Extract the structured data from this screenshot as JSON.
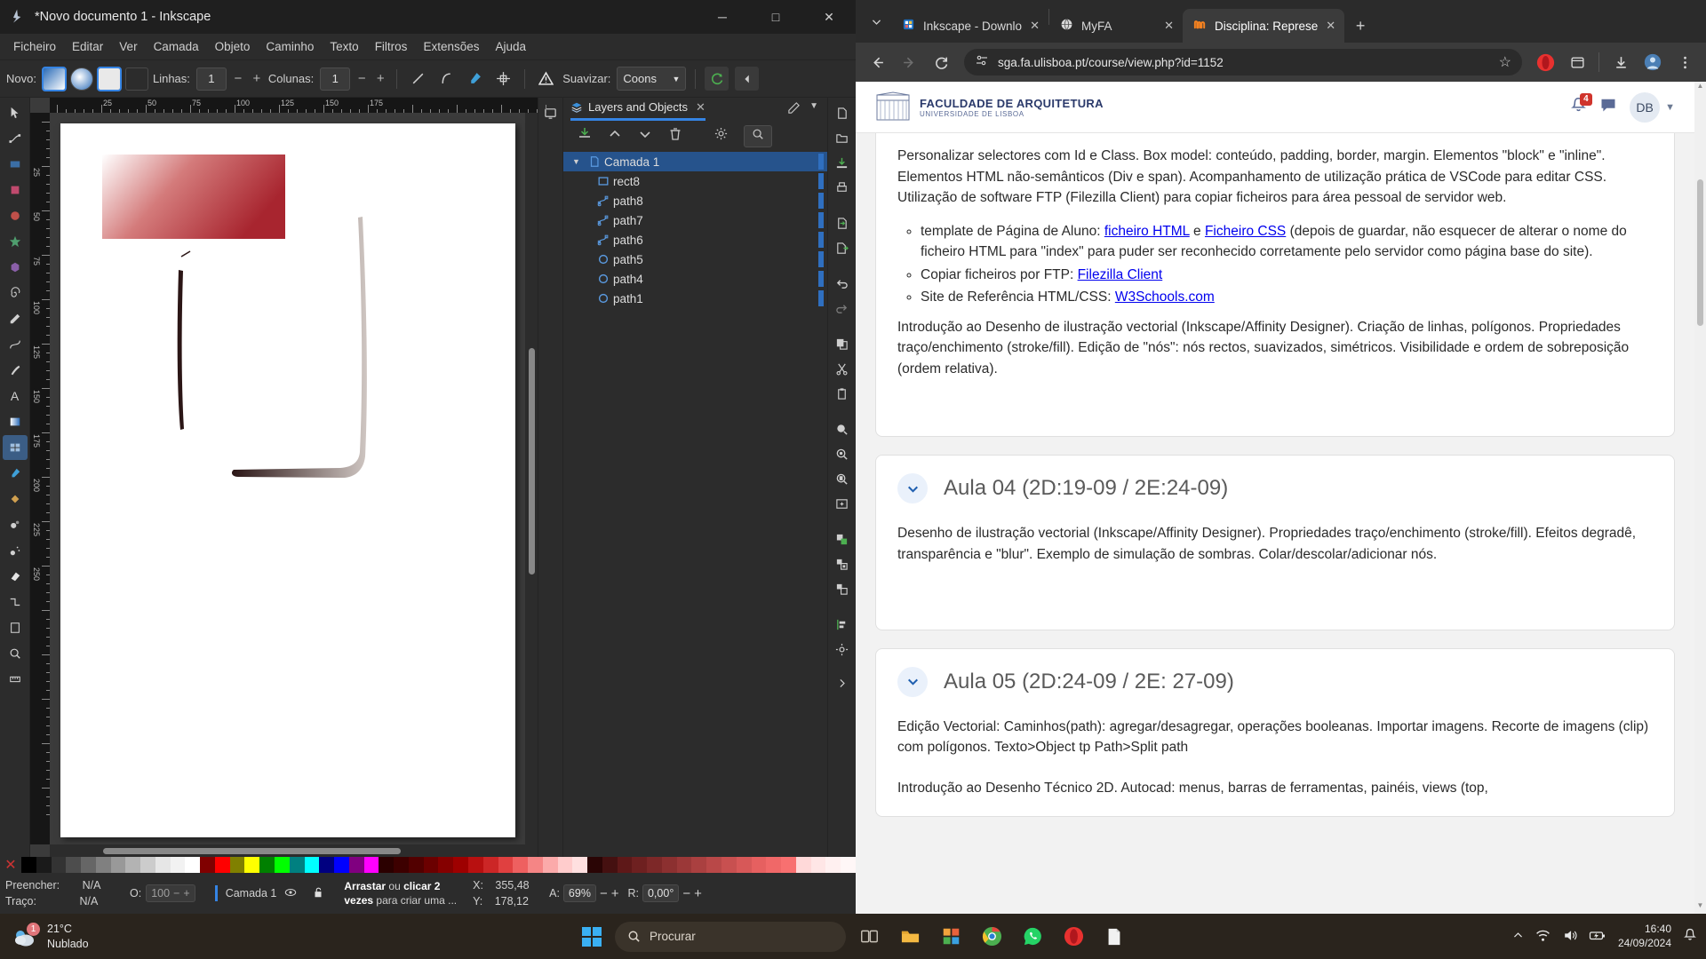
{
  "inkscape": {
    "title": "*Novo documento 1 - Inkscape",
    "window_controls": {
      "minimize": "─",
      "maximize": "□",
      "close": "✕"
    },
    "menus": [
      "Ficheiro",
      "Editar",
      "Ver",
      "Camada",
      "Objeto",
      "Caminho",
      "Texto",
      "Filtros",
      "Extensões",
      "Ajuda"
    ],
    "toolbar": {
      "novo_label": "Novo:",
      "linhas_label": "Linhas:",
      "linhas_value": "1",
      "colunas_label": "Colunas:",
      "colunas_value": "1",
      "suavizar_label": "Suavizar:",
      "suavizar_value": "Coons",
      "minus": "−",
      "plus": "+"
    },
    "dock": {
      "tab_label": "Layers and Objects",
      "tab_close": "✕",
      "layers": [
        {
          "name": "Camada 1",
          "icon": "layer-icon",
          "selected": true,
          "indent": false
        },
        {
          "name": "rect8",
          "icon": "rect-icon",
          "selected": false,
          "indent": true
        },
        {
          "name": "path8",
          "icon": "path-icon",
          "selected": false,
          "indent": true
        },
        {
          "name": "path7",
          "icon": "path-icon",
          "selected": false,
          "indent": true
        },
        {
          "name": "path6",
          "icon": "path-icon",
          "selected": false,
          "indent": true
        },
        {
          "name": "path5",
          "icon": "circle-icon",
          "selected": false,
          "indent": true
        },
        {
          "name": "path4",
          "icon": "circle-icon",
          "selected": false,
          "indent": true
        },
        {
          "name": "path1",
          "icon": "circle-icon",
          "selected": false,
          "indent": true
        }
      ]
    },
    "status": {
      "preencher_label": "Preencher:",
      "preencher_value": "N/A",
      "traco_label": "Traço:",
      "traco_value": "N/A",
      "opacity_label": "O:",
      "opacity_value": "100",
      "layer_name": "Camada 1",
      "hint_line1_bold_a": "Arrastar",
      "hint_line1_mid": " ou ",
      "hint_line1_bold_b": "clicar 2",
      "hint_line2_bold": "vezes",
      "hint_line2_rest": " para criar uma ...",
      "x_label": "X:",
      "x_value": "355,48",
      "y_label": "Y:",
      "y_value": "178,12",
      "zoom_label": "A:",
      "zoom_value": "69%",
      "rotate_label": "R:",
      "rotate_value": "0,00°",
      "minus": "−",
      "plus": "+"
    },
    "rulers": {
      "horizontal": [
        "25",
        "50",
        "75",
        "100",
        "125",
        "150",
        "175"
      ],
      "vertical": [
        "25",
        "50",
        "75",
        "100",
        "125",
        "150",
        "175",
        "200",
        "225",
        "250"
      ]
    }
  },
  "opera": {
    "tabs": [
      {
        "label": "Inkscape - Downlo",
        "icon": "inkscape-store-icon",
        "active": false,
        "close": "✕"
      },
      {
        "label": "MyFA",
        "icon": "globe-icon",
        "active": false,
        "close": "✕"
      },
      {
        "label": "Disciplina: Represe",
        "icon": "moodle-icon",
        "active": true,
        "close": "✕"
      }
    ],
    "new_tab": "+",
    "nav": {
      "back": "←",
      "forward": "→",
      "reload": "⟳",
      "url": "sga.fa.ulisboa.pt/course/view.php?id=1152",
      "bookmark": "☆"
    }
  },
  "moodle": {
    "brand_line1": "FACULDADE DE ARQUITETURA",
    "brand_line2": "UNIVERSIDADE DE LISBOA",
    "notification_count": "4",
    "user_initials": "DB",
    "section_prev": {
      "paragraph": "Personalizar selectores com Id e Class. Box model: conteúdo, padding, border, margin. Elementos \"block\" e \"inline\". Elementos HTML não-semânticos (Div e span).  Acompanhamento de utilização prática de VSCode para editar CSS. Utilização de software FTP (Filezilla Client) para copiar ficheiros para área pessoal de servidor web.",
      "bullets": [
        {
          "pre": "template de Página de Aluno: ",
          "link1": "ficheiro HTML",
          "mid": " e ",
          "link2": "Ficheiro CSS",
          "post": " (depois de guardar, não esquecer de alterar o nome do ficheiro HTML para \"index\" para puder ser reconhecido corretamente pelo servidor como página base do site)."
        },
        {
          "pre": "Copiar ficheiros por FTP: ",
          "link1": "Filezilla Client",
          "mid": "",
          "link2": "",
          "post": ""
        },
        {
          "pre": "Site de Referência HTML/CSS: ",
          "link1": "W3Schools.com",
          "mid": "",
          "link2": "",
          "post": ""
        }
      ],
      "paragraph2": "Introdução ao Desenho de ilustração vectorial (Inkscape/Affinity Designer). Criação de linhas, polígonos. Propriedades traço/enchimento (stroke/fill). Edição de \"nós\": nós rectos, suavizados, simétricos. Visibilidade e ordem de sobreposição (ordem relativa)."
    },
    "section_aula04": {
      "title": "Aula 04 (2D:19-09 / 2E:24-09)",
      "toggle_icon": "chevron-down-icon",
      "paragraph": "Desenho de ilustração vectorial (Inkscape/Affinity Designer). Propriedades traço/enchimento (stroke/fill). Efeitos degradê, transparência e \"blur\". Exemplo de simulação de sombras. Colar/descolar/adicionar nós."
    },
    "section_aula05": {
      "title": "Aula 05 (2D:24-09 / 2E: 27-09)",
      "toggle_icon": "chevron-down-icon",
      "paragraph1": "Edição Vectorial: Caminhos(path): agregar/desagregar, operações booleanas. Importar imagens. Recorte de imagens (clip) com polígonos. Texto>Object tp Path>Split path",
      "paragraph2": "Introdução ao Desenho Técnico 2D. Autocad: menus, barras de ferramentas, painéis, views (top,"
    }
  },
  "taskbar": {
    "weather_temp": "21°C",
    "weather_desc": "Nublado",
    "weather_badge": "1",
    "search_placeholder": "Procurar",
    "clock_time": "16:40",
    "clock_date": "24/09/2024"
  },
  "colors": {
    "accent_blue": "#3584e4",
    "moodle_link": "#2a6bb5",
    "badge_red": "#d0342c",
    "opera_red": "#e8312f"
  }
}
